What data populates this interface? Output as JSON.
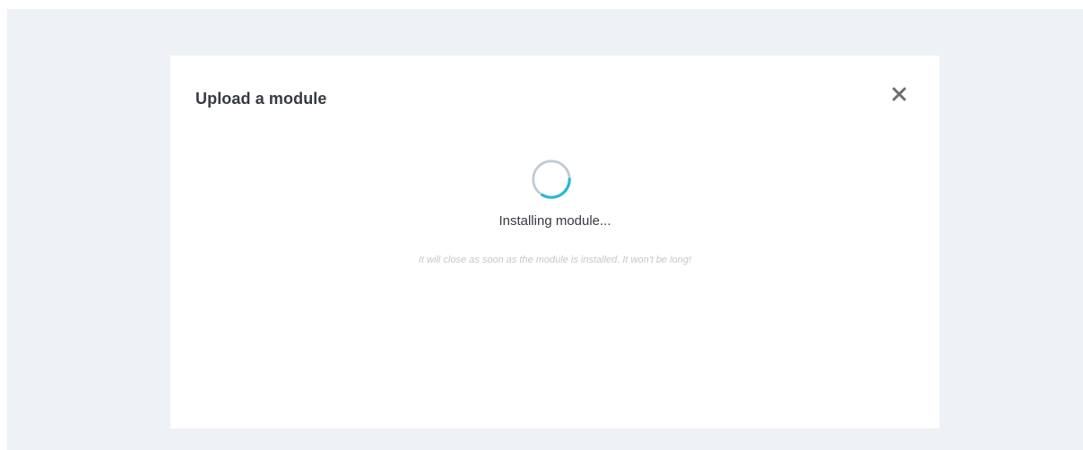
{
  "modal": {
    "title": "Upload a module",
    "close_icon": "close-icon",
    "spinner_icon": "loading-spinner-icon",
    "status": "Installing module...",
    "hint": "It will close as soon as the module is installed. It won't be long!"
  },
  "colors": {
    "backdrop": "#eef1f5",
    "modal_background": "#ffffff",
    "title": "#363a41",
    "close_icon": "#6c6e70",
    "spinner_track": "#bfcad3",
    "spinner_accent": "#25b9d7",
    "hint": "#c4c8cc"
  }
}
